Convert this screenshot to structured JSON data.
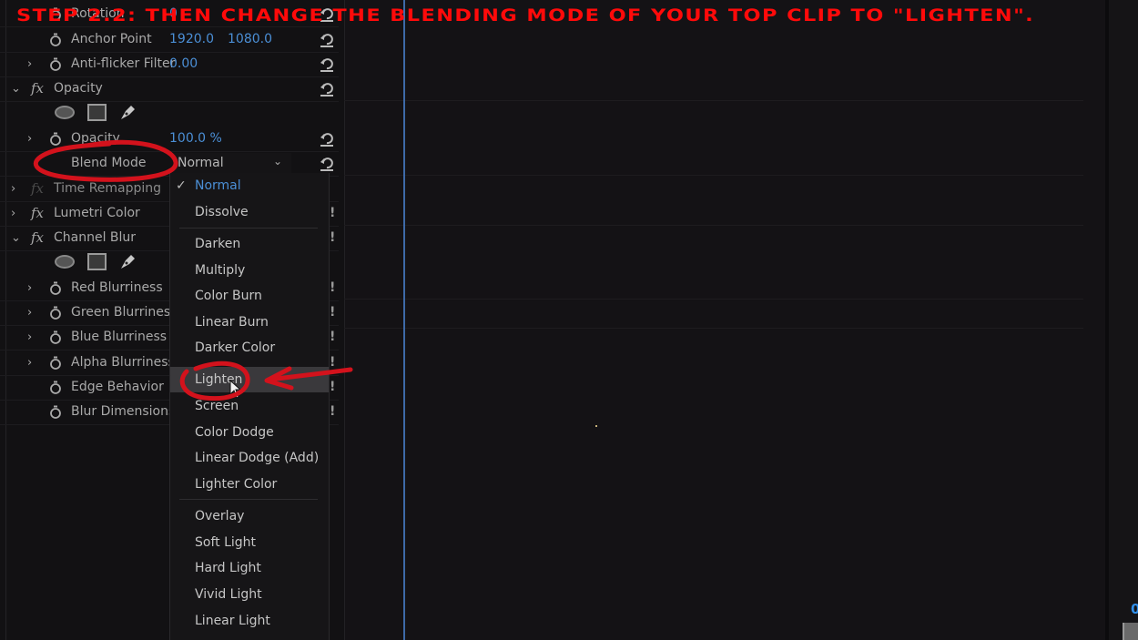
{
  "title_overlay": "STEP 2.2: THEN CHANGE THE BLENDING MODE OF YOUR TOP CLIP TO \"LIGHTEN\".",
  "colors": {
    "accent_blue": "#4b8fd6",
    "annotation_red": "#ff0a0a",
    "playhead": "#3e6aa8"
  },
  "effect_controls": {
    "rows": [
      {
        "kind": "property",
        "label": "Rotation",
        "value": "0"
      },
      {
        "kind": "property",
        "label": "Anchor Point",
        "value": "1920.0",
        "value2": "1080.0"
      },
      {
        "kind": "property",
        "label": "Anti-flicker Filter",
        "value": "0.00"
      },
      {
        "kind": "effect",
        "label": "Opacity",
        "fx": "fx"
      },
      {
        "kind": "property",
        "label": "Opacity",
        "value": "100.0 %"
      },
      {
        "kind": "property",
        "label": "Blend Mode"
      },
      {
        "kind": "effect",
        "label": "Time Remapping",
        "fx": "fx"
      },
      {
        "kind": "effect",
        "label": "Lumetri Color",
        "fx": "fx"
      },
      {
        "kind": "effect",
        "label": "Channel Blur",
        "fx": "fx"
      },
      {
        "kind": "property",
        "label": "Red Blurriness"
      },
      {
        "kind": "property",
        "label": "Green Blurriness"
      },
      {
        "kind": "property",
        "label": "Blue Blurriness"
      },
      {
        "kind": "property",
        "label": "Alpha Blurriness"
      },
      {
        "kind": "property",
        "label": "Edge Behavior"
      },
      {
        "kind": "property",
        "label": "Blur Dimensions"
      }
    ]
  },
  "blend_mode": {
    "current_value": "Normal",
    "options": [
      {
        "label": "Normal",
        "selected": true
      },
      {
        "label": "Dissolve"
      },
      {
        "label": "Darken"
      },
      {
        "label": "Multiply"
      },
      {
        "label": "Color Burn"
      },
      {
        "label": "Linear Burn"
      },
      {
        "label": "Darker Color"
      },
      {
        "label": "Lighten",
        "hovered": true
      },
      {
        "label": "Screen"
      },
      {
        "label": "Color Dodge"
      },
      {
        "label": "Linear Dodge (Add)"
      },
      {
        "label": "Lighter Color"
      },
      {
        "label": "Overlay"
      },
      {
        "label": "Soft Light"
      },
      {
        "label": "Hard Light"
      },
      {
        "label": "Vivid Light"
      },
      {
        "label": "Linear Light"
      }
    ]
  },
  "timecode_partial": "0"
}
